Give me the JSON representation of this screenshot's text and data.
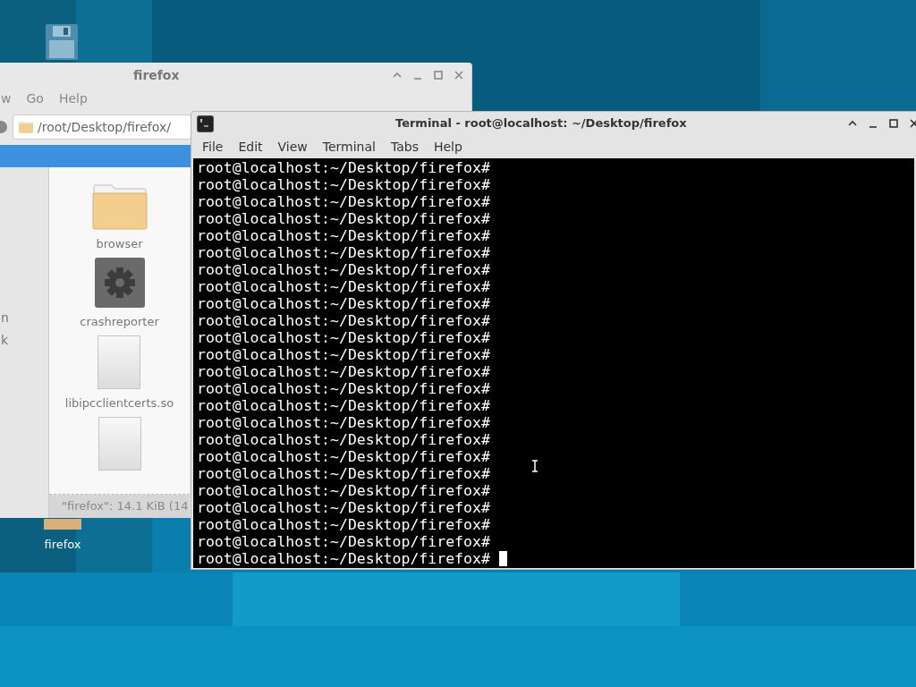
{
  "desktop": {
    "icons": [
      {
        "kind": "floppy"
      },
      {
        "kind": "folder",
        "label": "firefox"
      }
    ]
  },
  "file_manager": {
    "title": "firefox",
    "menu": [
      "w",
      "Go",
      "Help"
    ],
    "location": "/root/Desktop/firefox/",
    "sidebar_items": [
      "n",
      "k"
    ],
    "files": [
      {
        "kind": "folder",
        "name": "browser"
      },
      {
        "kind": "executable",
        "name": "crashreporter"
      },
      {
        "kind": "file",
        "name": "libipcclientcerts.so"
      },
      {
        "kind": "file"
      }
    ],
    "status_bar": "\"firefox\": 14.1 KiB (14"
  },
  "terminal": {
    "title": "Terminal - root@localhost: ~/Desktop/firefox",
    "menu": [
      "File",
      "Edit",
      "View",
      "Terminal",
      "Tabs",
      "Help"
    ],
    "lines": [
      "root@localhost:~/Desktop/firefox#",
      "root@localhost:~/Desktop/firefox#",
      "root@localhost:~/Desktop/firefox#",
      "root@localhost:~/Desktop/firefox#",
      "root@localhost:~/Desktop/firefox#",
      "root@localhost:~/Desktop/firefox#",
      "root@localhost:~/Desktop/firefox#",
      "root@localhost:~/Desktop/firefox#",
      "root@localhost:~/Desktop/firefox#",
      "root@localhost:~/Desktop/firefox#",
      "root@localhost:~/Desktop/firefox#",
      "root@localhost:~/Desktop/firefox#",
      "root@localhost:~/Desktop/firefox#",
      "root@localhost:~/Desktop/firefox#",
      "root@localhost:~/Desktop/firefox#",
      "root@localhost:~/Desktop/firefox#",
      "root@localhost:~/Desktop/firefox#",
      "root@localhost:~/Desktop/firefox#",
      "root@localhost:~/Desktop/firefox#",
      "root@localhost:~/Desktop/firefox#",
      "root@localhost:~/Desktop/firefox#",
      "root@localhost:~/Desktop/firefox#",
      "root@localhost:~/Desktop/firefox#",
      "root@localhost:~/Desktop/firefox#"
    ]
  }
}
